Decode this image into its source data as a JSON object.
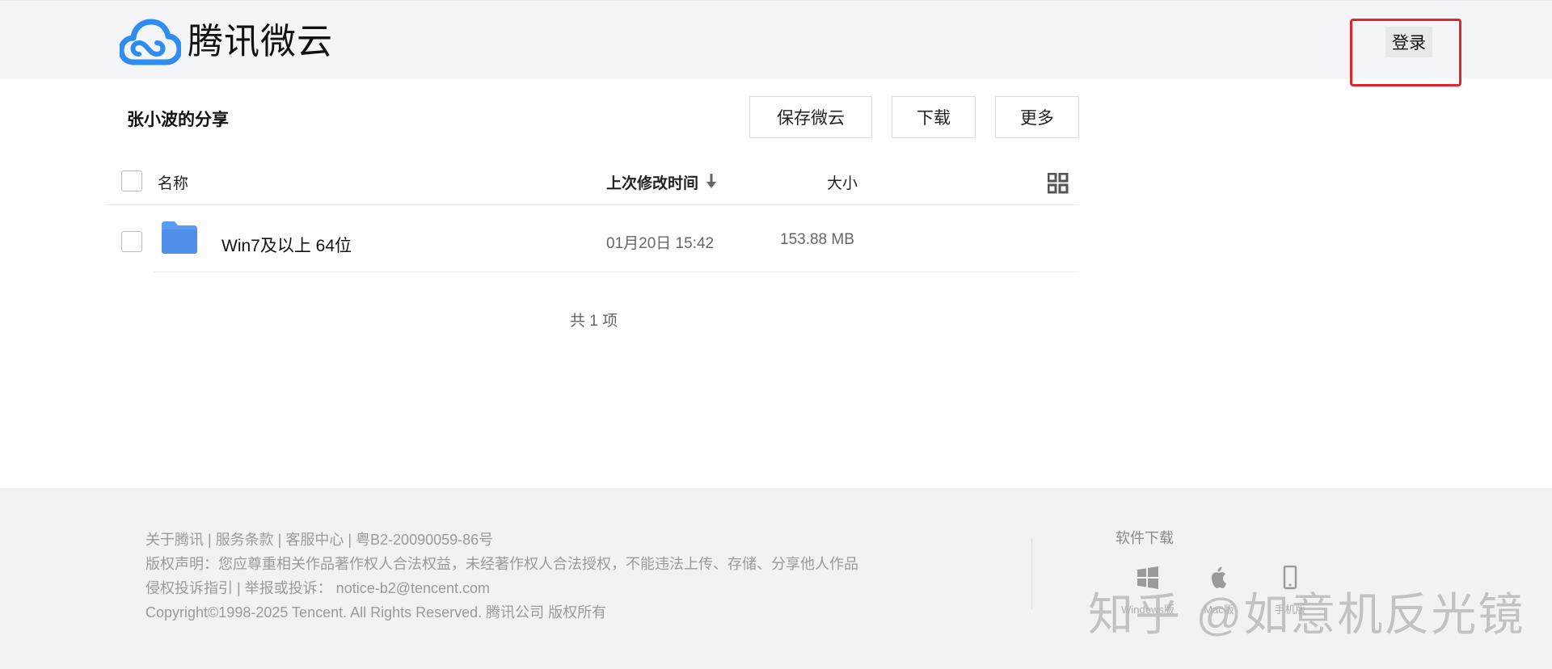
{
  "header": {
    "logo_text": "腾讯微云",
    "login_label": "登录"
  },
  "share": {
    "title": "张小波的分享",
    "buttons": {
      "save": "保存微云",
      "download": "下载",
      "more": "更多"
    }
  },
  "table": {
    "columns": {
      "name": "名称",
      "modified": "上次修改时间",
      "size": "大小"
    },
    "rows": [
      {
        "name": "Win7及以上 64位",
        "modified": "01月20日 15:42",
        "size": "153.88 MB"
      }
    ],
    "total": "共 1 项"
  },
  "footer": {
    "line1": "关于腾讯 | 服务条款 | 客服中心 | 粤B2-20090059-86号",
    "line2": "版权声明：您应尊重相关作品著作权人合法权益，未经著作权人合法授权，不能违法上传、存储、分享他人作品",
    "line3": "侵权投诉指引 | 举报或投诉： notice-b2@tencent.com",
    "line4": "Copyright©1998-2025 Tencent. All Rights Reserved. 腾讯公司 版权所有",
    "download_title": "软件下载",
    "platforms": [
      {
        "label": "Windows版",
        "icon": "windows-icon"
      },
      {
        "label": "Mac版",
        "icon": "apple-icon"
      },
      {
        "label": "手机版",
        "icon": "mobile-icon"
      }
    ]
  },
  "watermark": "知乎 @如意机反光镜",
  "colors": {
    "topbar_bg": "#f3f5f8",
    "highlight_red": "#e0262a",
    "folder_blue": "#5b9cf3",
    "footer_bg": "#f2f2f2"
  }
}
